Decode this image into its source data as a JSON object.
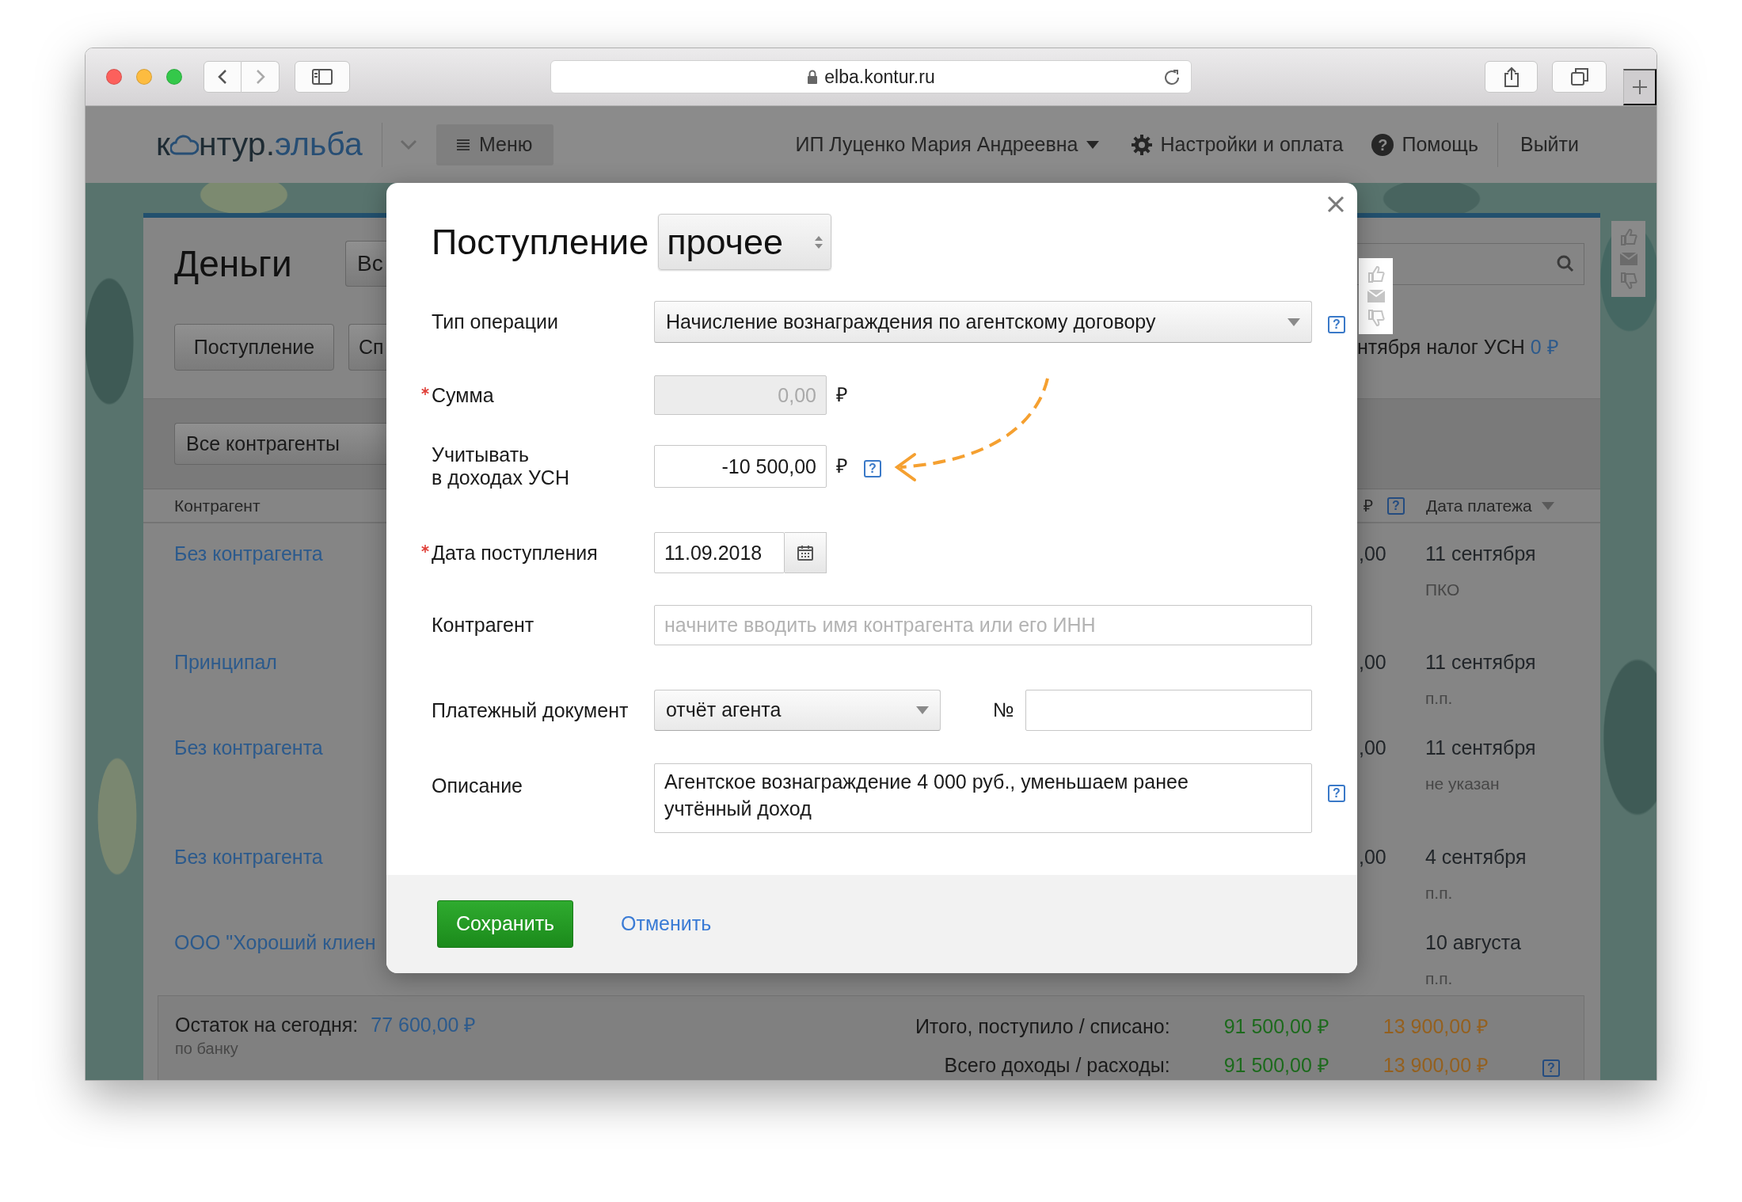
{
  "browser": {
    "url": "elba.kontur.ru"
  },
  "header": {
    "logo": {
      "lead": "к",
      "tail": "нтур.",
      "accent": "эльба"
    },
    "menu": "Меню",
    "account": "ИП Луценко Мария Андреевна",
    "settings": "Настройки и оплата",
    "help": {
      "icon": "?",
      "label": "Помощь"
    },
    "logout": "Выйти"
  },
  "page": {
    "title": "Деньги",
    "filter_button": "Вс",
    "action_buttons": [
      "Поступление",
      "Сп"
    ],
    "counterparty_filter": "Все контрагенты",
    "tax_notice": {
      "text": "нтября налог УСН",
      "amount": "0 ₽"
    },
    "table": {
      "columns": [
        {
          "label": "Контрагент"
        },
        {
          "label": "₽",
          "help": "?"
        },
        {
          "label": "Дата платежа",
          "sorted": true
        }
      ],
      "rows": [
        {
          "counterparty": "Без контрагента",
          "amount": ",00",
          "date": "11 сентября",
          "document": "ПКО"
        },
        {
          "counterparty": "Принципал",
          "amount": ",00",
          "date": "11 сентября",
          "document": "п.п."
        },
        {
          "counterparty": "Без контрагента",
          "amount": ",00",
          "date": "11 сентября",
          "document": "не указан"
        },
        {
          "counterparty": "Без контрагента",
          "amount": ",00",
          "date": "4 сентября",
          "document": "п.п."
        },
        {
          "counterparty": "ООО \"Хороший клиен",
          "date": "10 августа",
          "document": "п.п."
        }
      ]
    },
    "summary": {
      "balance_label": "Остаток на сегодня:",
      "balance": "77 600,00 ₽",
      "balance_note": "по банку",
      "totals": [
        {
          "label": "Итого, поступило / списано:",
          "income": "91 500,00 ₽",
          "expense": "13 900,00 ₽"
        },
        {
          "label": "Всего доходы / расходы:",
          "income": "91 500,00 ₽",
          "expense": "13 900,00 ₽",
          "help": "?"
        }
      ]
    }
  },
  "dialog": {
    "title": "Поступление",
    "subtype": "прочее",
    "fields": [
      {
        "kind": "select",
        "label": "Тип операции",
        "required": false,
        "value": "Начисление вознаграждения по агентскому договору",
        "help": "?"
      },
      {
        "kind": "input",
        "label": "Сумма",
        "required": true,
        "value": "0,00",
        "disabled": true,
        "unit": "₽"
      },
      {
        "kind": "input",
        "label": "Учитывать\nв доходах УСН",
        "required": false,
        "value": "-10 500,00",
        "disabled": false,
        "unit": "₽",
        "help": "?"
      },
      {
        "kind": "date",
        "label": "Дата поступления",
        "required": true,
        "value": "11.09.2018"
      },
      {
        "kind": "text",
        "label": "Контрагент",
        "required": false,
        "placeholder": "начните вводить имя контрагента или его ИНН"
      },
      {
        "kind": "select_number",
        "label": "Платежный документ",
        "required": false,
        "value": "отчёт агента",
        "number_label": "№"
      },
      {
        "kind": "textarea",
        "label": "Описание",
        "required": false,
        "value": "Агентское вознаграждение 4 000 руб., уменьшаем ранее учтённый доход",
        "help": "?"
      }
    ],
    "save": "Сохранить",
    "cancel": "Отменить"
  }
}
